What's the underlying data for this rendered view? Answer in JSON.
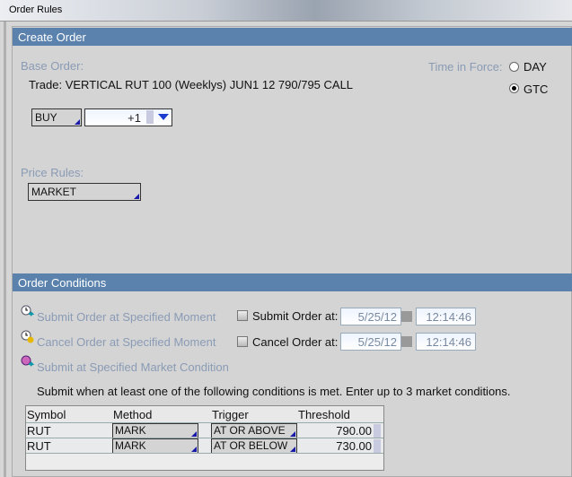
{
  "window": {
    "title": "Order Rules"
  },
  "create_order": {
    "header": "Create Order",
    "base_order_label": "Base Order:",
    "trade_text": "Trade:  VERTICAL RUT 100 (Weeklys) JUN1 12 790/795 CALL",
    "side": "BUY",
    "quantity": "+1",
    "time_in_force_label": "Time in Force:",
    "tif_options": [
      {
        "label": "DAY",
        "selected": false
      },
      {
        "label": "GTC",
        "selected": true
      }
    ],
    "price_rules_label": "Price Rules:",
    "price_rule": "MARKET"
  },
  "order_conditions": {
    "header": "Order Conditions",
    "links": [
      "Submit Order at Specified Moment",
      "Cancel Order at Specified Moment",
      "Submit at Specified Market Condition"
    ],
    "submit_at": {
      "label": "Submit Order at:",
      "date": "5/25/12",
      "time": "12:14:46",
      "checked": false
    },
    "cancel_at": {
      "label": "Cancel Order at:",
      "date": "5/25/12",
      "time": "12:14:46",
      "checked": false
    },
    "instructions": "Submit when at least one of the following conditions is met. Enter up to 3 market conditions.",
    "table": {
      "columns": [
        "Symbol",
        "Method",
        "Trigger",
        "Threshold"
      ],
      "rows": [
        [
          "RUT",
          "MARK",
          "AT OR ABOVE",
          "790.00"
        ],
        [
          "RUT",
          "MARK",
          "AT OR BELOW",
          "730.00"
        ]
      ]
    }
  },
  "colors": {
    "header": "#5b82ad",
    "label": "#8a9bb5"
  }
}
